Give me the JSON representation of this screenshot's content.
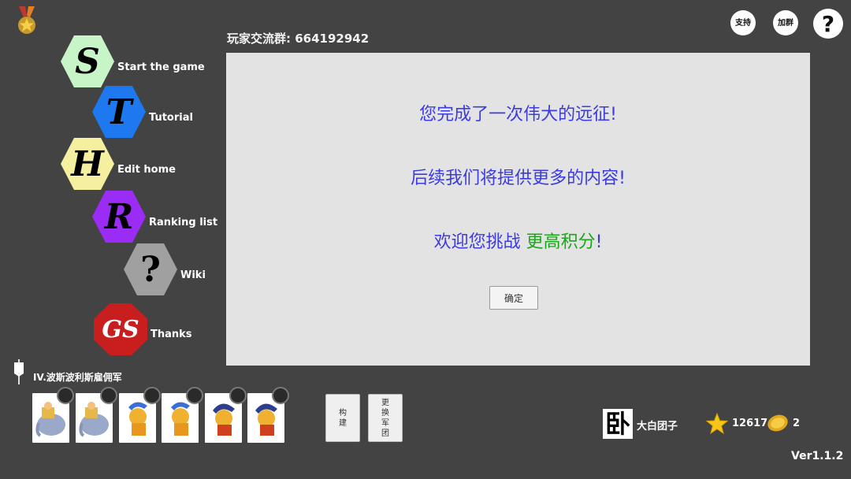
{
  "community": {
    "label": "玩家交流群: ",
    "number": "664192942"
  },
  "top_buttons": {
    "support": "支持",
    "join_group": "加群",
    "help": "?"
  },
  "menu": [
    {
      "id": "start",
      "letter": "S",
      "label": "Start the game",
      "color": "#c8f5c8"
    },
    {
      "id": "tutorial",
      "letter": "T",
      "label": "Tutorial",
      "color": "#1e78f0"
    },
    {
      "id": "edit",
      "letter": "H",
      "label": "Edit home",
      "color": "#f5f0a0"
    },
    {
      "id": "ranking",
      "letter": "R",
      "label": "Ranking list",
      "color": "#9a2cf5"
    },
    {
      "id": "wiki",
      "letter": "?",
      "label": "Wiki",
      "color": "#a0a0a0"
    },
    {
      "id": "thanks",
      "letter": "GS",
      "label": "Thanks",
      "color": "#c81e1e"
    }
  ],
  "dialog": {
    "line1": "您完成了一次伟大的远征!",
    "line2": "后续我们将提供更多的内容!",
    "line3_prefix": "欢迎您挑战 ",
    "line3_highlight": "更高积分",
    "line3_suffix": "!",
    "confirm_label": "确定"
  },
  "legion": {
    "name": "IV.波斯波利斯雇佣军",
    "units": [
      {
        "type": "elephant"
      },
      {
        "type": "elephant"
      },
      {
        "type": "spartan-gold"
      },
      {
        "type": "spartan-gold"
      },
      {
        "type": "spartan-blue"
      },
      {
        "type": "spartan-blue"
      }
    ]
  },
  "actions": {
    "build": "构建",
    "change_legion": "更换军团"
  },
  "player": {
    "avatar_char": "卧",
    "name": "大白团子",
    "score": "12617",
    "coins": "2"
  },
  "version": "Ver1.1.2",
  "colors": {
    "background": "#434343",
    "dialog_bg": "#e3e3e3",
    "dialog_text": "#3b3be0",
    "highlight": "#1aa51a"
  }
}
